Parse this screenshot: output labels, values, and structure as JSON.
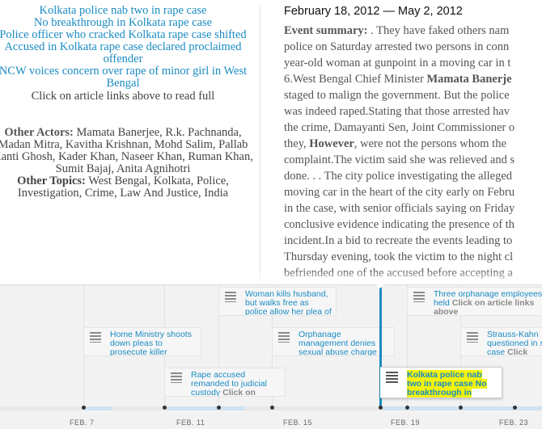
{
  "related_links": [
    "Kolkata police nab two in rape case",
    "No breakthrough in Kolkata rape case",
    "Police officer who cracked Kolkata rape case shifted",
    "Accused in Kolkata rape case declared proclaimed offender",
    "NCW voices concern over rape of minor girl in West Bengal"
  ],
  "read_full_text": "Click on article links above to read full",
  "other_actors_label": "Other Actors:",
  "other_actors": "Mamata Banerjee, R.k. Pachnanda, Madan Mitra, Kavitha Krishnan, Mohd Salim, Pallab Kanti Ghosh, Kader Khan, Naseer Khan, Ruman Khan, Sumit Bajaj, Anita Agnihotri",
  "other_topics_label": "Other Topics:",
  "other_topics": "West Bengal, Kolkata, Police, Investigation, Crime, Law And Justice, India",
  "date_range": "February 18, 2012 — May 2, 2012",
  "event_summary_label": "Event summary:",
  "summary_lines": [
    ". They have faked others nam",
    "police on Saturday arrested two persons in conn",
    "year-old woman at gunpoint in a moving car in t",
    "6.West Bengal Chief Minister |Mamata Banerje",
    "staged to malign the government. But the police",
    "was indeed raped.Stating that those arrested hav",
    "the crime, Damayanti Sen, Joint Commissioner o",
    "they, |However|, were not the persons whom the",
    "complaint.The victim said she was relieved and s",
    "done. . . The city police investigating the alleged",
    "moving car in the heart of the city early on Febru",
    "in the case, with senior officials saying on Friday",
    "conclusive evidence indicating the presence of th",
    "incident.In a bid to recreate the events leading to",
    "Thursday evening, took the victim to the night cl",
    "befriended one of the accused before accepting a"
  ],
  "timeline": {
    "cards": [
      {
        "title": "Woman kills husband, but walks free as police allow her plea of",
        "extra": ""
      },
      {
        "title": "Three orphanage employees held ",
        "extra": "Click on article links above"
      },
      {
        "title": "Home Ministry shoots down pleas to prosecute killer",
        "extra": ""
      },
      {
        "title": "Orphanage management denies sexual abuse charge",
        "extra": ""
      },
      {
        "title": "Strauss-Kahn questioned in sex case ",
        "extra": "Click"
      },
      {
        "title": "Rape accused remanded to judicial custody ",
        "extra": "Click on"
      }
    ],
    "selected_card": "Kolkata police nab two in rape case No breakthrough in",
    "axis_labels": [
      "FEB. 7",
      "FEB. 11",
      "FEB. 15",
      "FEB. 19",
      "FEB. 23"
    ]
  }
}
